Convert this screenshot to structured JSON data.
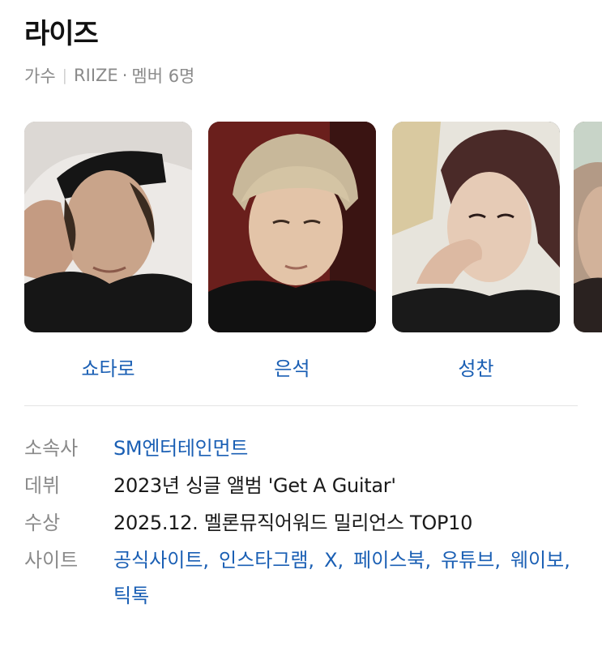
{
  "header": {
    "title": "라이즈",
    "category": "가수",
    "separator": "|",
    "group_name": "RIIZE",
    "dot": "·",
    "member_count": "멤버 6명"
  },
  "members": [
    {
      "name": "쇼타로"
    },
    {
      "name": "은석"
    },
    {
      "name": "성찬"
    }
  ],
  "info": {
    "agency": {
      "label": "소속사",
      "value": "SM엔터테인먼트"
    },
    "debut": {
      "label": "데뷔",
      "value": "2023년 싱글 앨범 'Get A Guitar'"
    },
    "award": {
      "label": "수상",
      "value": "2025.12. 멜론뮤직어워드 밀리언스 TOP10"
    },
    "sites": {
      "label": "사이트",
      "links": [
        "공식사이트,",
        "인스타그램,",
        "X,",
        "페이스북,",
        "유튜브,",
        "웨이보,",
        "틱톡"
      ]
    }
  },
  "colors": {
    "link": "#1a5fb4",
    "label": "#8a8a8a",
    "text": "#1a1a1a"
  }
}
